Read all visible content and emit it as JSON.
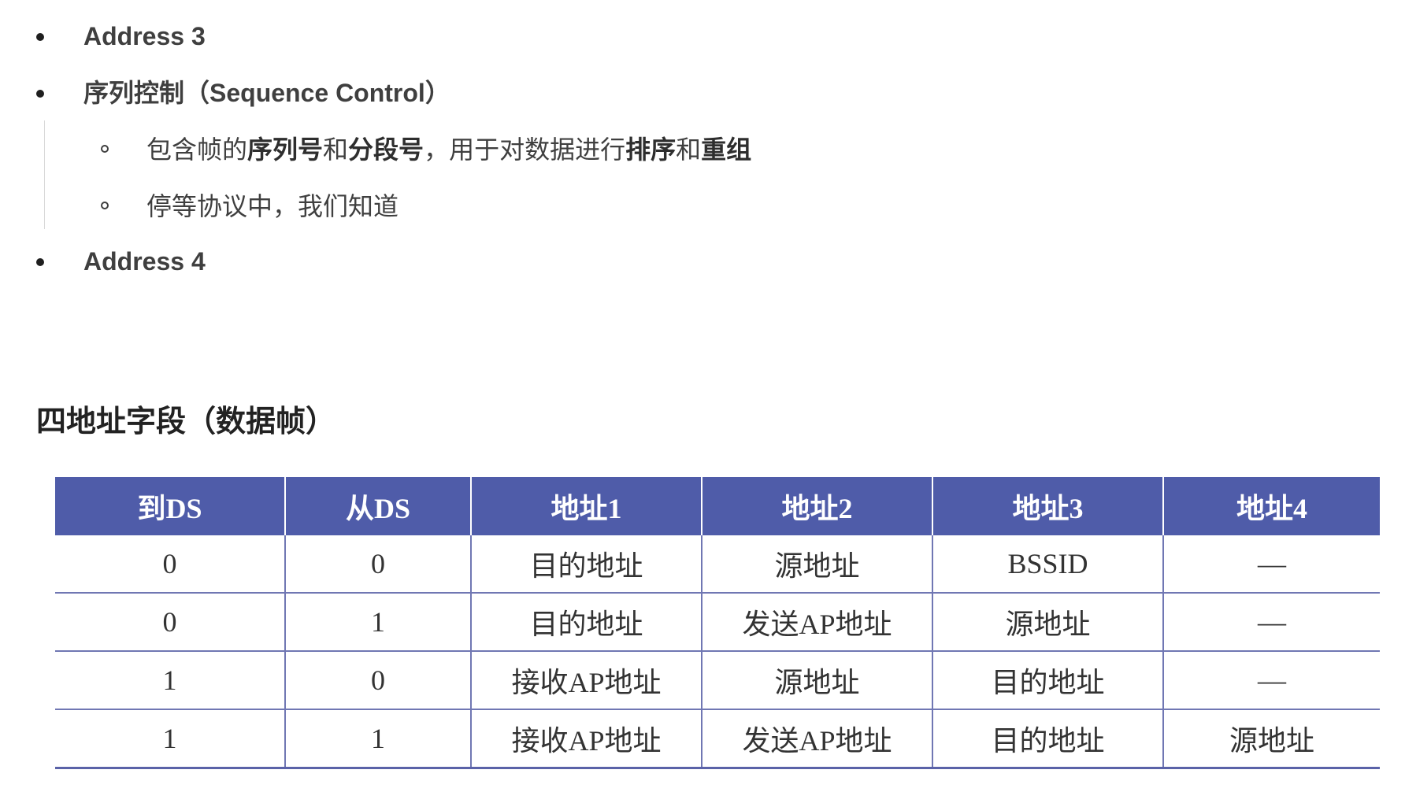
{
  "list": {
    "items": [
      {
        "text": "Address 3"
      },
      {
        "text": "序列控制（Sequence Control）"
      },
      {
        "text": "Address 4"
      }
    ],
    "sub_items": [
      {
        "parts": [
          {
            "t": "包含帧的",
            "b": false
          },
          {
            "t": "序列号",
            "b": true
          },
          {
            "t": "和",
            "b": false
          },
          {
            "t": "分段号",
            "b": true
          },
          {
            "t": "，用于对数据进行",
            "b": false
          },
          {
            "t": "排序",
            "b": true
          },
          {
            "t": "和",
            "b": false
          },
          {
            "t": "重组",
            "b": true
          }
        ]
      },
      {
        "parts": [
          {
            "t": "停等协议中，我们知道",
            "b": false
          }
        ]
      }
    ]
  },
  "section": {
    "heading": "四地址字段（数据帧）"
  },
  "table": {
    "headers": [
      "到DS",
      "从DS",
      "地址1",
      "地址2",
      "地址3",
      "地址4"
    ],
    "rows": [
      [
        "0",
        "0",
        "目的地址",
        "源地址",
        "BSSID",
        "—"
      ],
      [
        "0",
        "1",
        "目的地址",
        "发送AP地址",
        "源地址",
        "—"
      ],
      [
        "1",
        "0",
        "接收AP地址",
        "源地址",
        "目的地址",
        "—"
      ],
      [
        "1",
        "1",
        "接收AP地址",
        "发送AP地址",
        "目的地址",
        "源地址"
      ]
    ]
  }
}
